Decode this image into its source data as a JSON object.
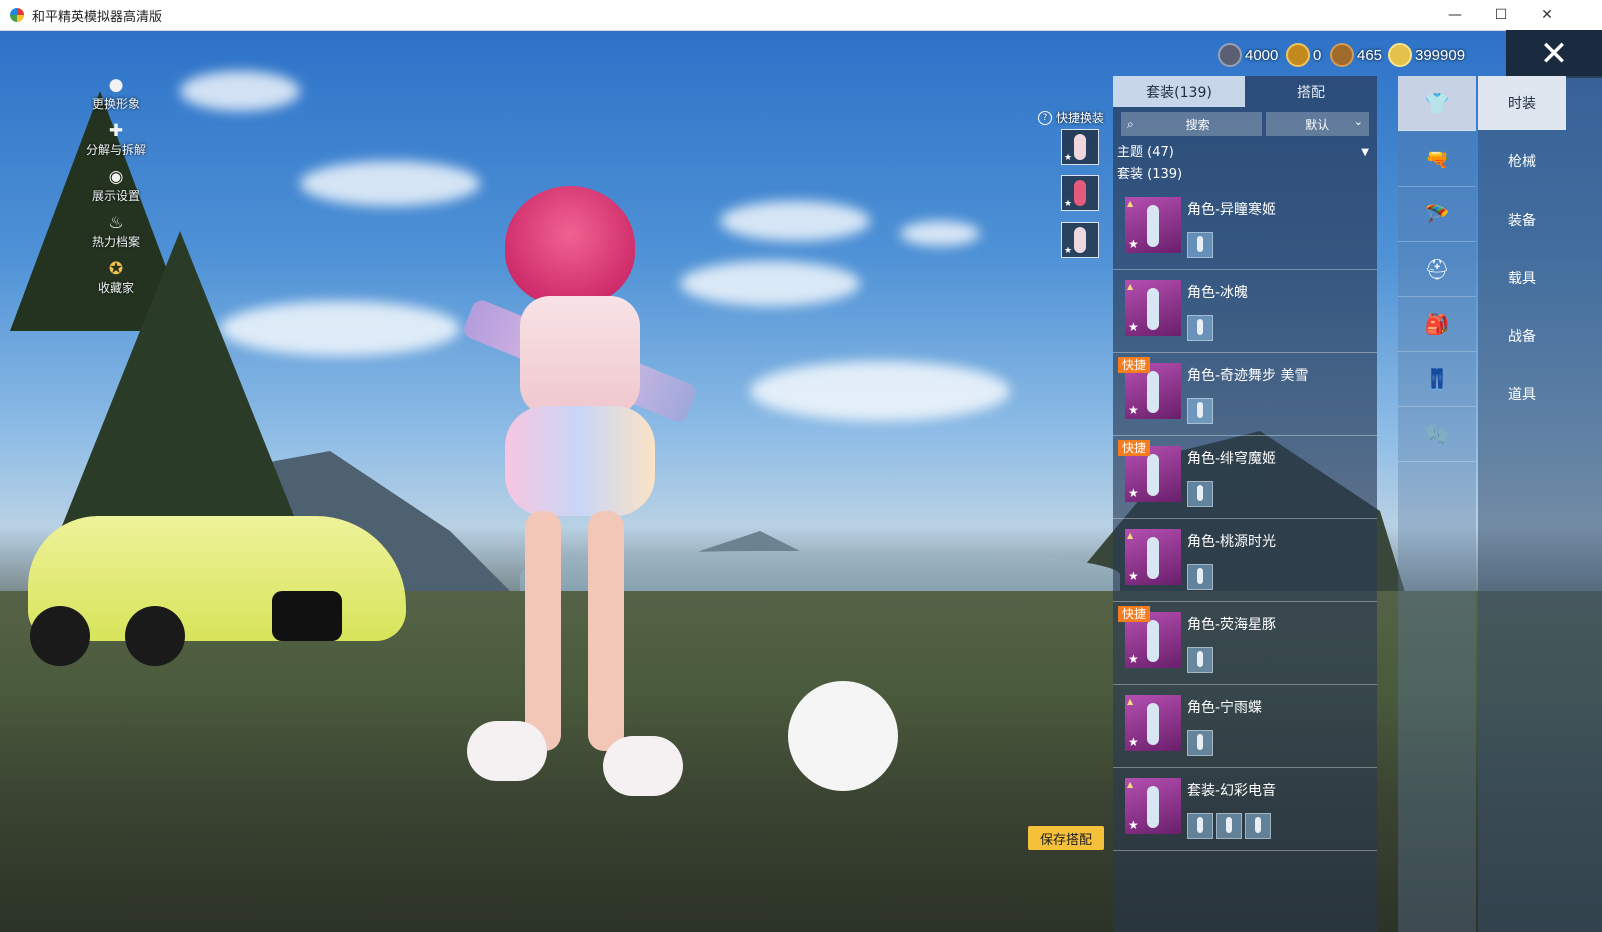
{
  "window": {
    "title": "和平精英模拟器高清版",
    "minimize": "—",
    "maximize": "☐",
    "close": "✕"
  },
  "left_menu": [
    {
      "label": "更换形象",
      "icon": "avatar-icon"
    },
    {
      "label": "分解与拆解",
      "icon": "puzzle-icon"
    },
    {
      "label": "展示设置",
      "icon": "eye-icon"
    },
    {
      "label": "热力档案",
      "icon": "flame-icon"
    },
    {
      "label": "收藏家",
      "icon": "medal-icon"
    }
  ],
  "currencies": [
    {
      "value": "4000",
      "color": "#5a5f73"
    },
    {
      "value": "0",
      "color": "#c28a1e"
    },
    {
      "value": "465",
      "color": "#a06a2a"
    },
    {
      "value": "399909",
      "color": "#e3c14a"
    }
  ],
  "close_big": "✕",
  "quick_swap": {
    "label": "快捷换装",
    "help": "?"
  },
  "panel": {
    "tabs": [
      "套装(139)",
      "搭配"
    ],
    "search_placeholder": "搜索",
    "sort": "默认",
    "theme_line": "主题 (47)",
    "suit_line": "套装 (139)"
  },
  "items": [
    {
      "name": "角色-异瞳寒姬",
      "quick": false
    },
    {
      "name": "角色-冰魄",
      "quick": false
    },
    {
      "name": "角色-奇迹舞步 美雪",
      "quick": true
    },
    {
      "name": "角色-绯穹魔姬",
      "quick": true
    },
    {
      "name": "角色-桃源时光",
      "quick": false
    },
    {
      "name": "角色-荧海星豚",
      "quick": true
    },
    {
      "name": "角色-宁雨蝶",
      "quick": false
    },
    {
      "name": "套装-幻彩电音",
      "quick": false
    }
  ],
  "quick_badge": "快捷",
  "categories": [
    "时装",
    "枪械",
    "装备",
    "载具",
    "战备",
    "道具"
  ],
  "icon_column": [
    "outfit-icon",
    "gun-icon",
    "skydive-icon",
    "helmet-icon",
    "backpack-icon",
    "pants-icon",
    "glove-icon"
  ],
  "save_button": "保存搭配",
  "colors": {
    "accent": "#f5c03a",
    "quick_badge": "#f57c1f"
  }
}
